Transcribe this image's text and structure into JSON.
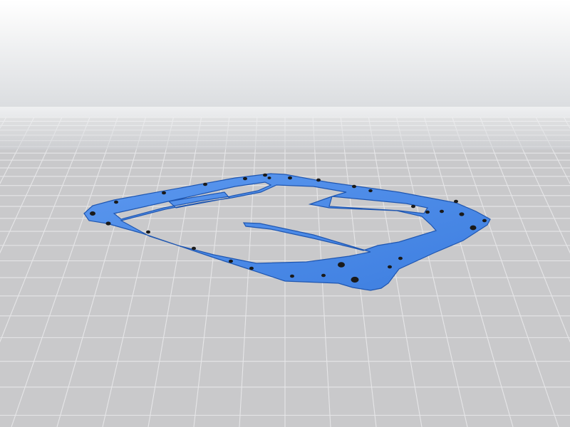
{
  "scene": {
    "subject": "gasket-plate",
    "colors": {
      "sky_top": "#ffffff",
      "sky_horizon": "#cfd2d6",
      "bed": "#c9c9cb",
      "grid_line": "#e6e6e8",
      "part_main": "#3d7ee0",
      "part_light": "#5b97ee",
      "part_edge": "#1f56b0",
      "hole": "#1a1a1a"
    }
  }
}
